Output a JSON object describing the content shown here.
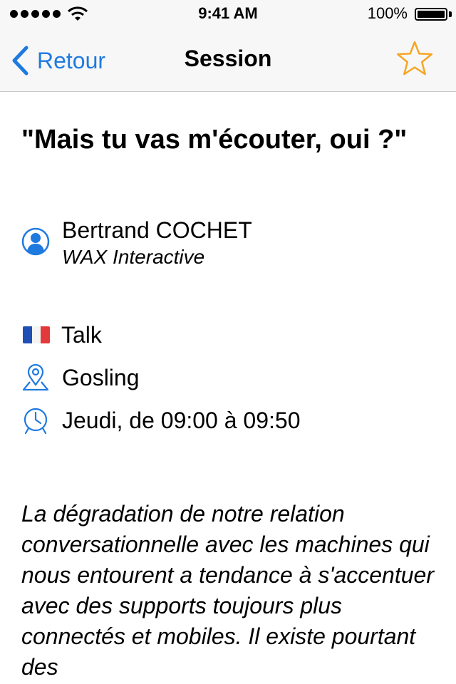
{
  "status_bar": {
    "time": "9:41 AM",
    "battery": "100%"
  },
  "nav": {
    "back_label": "Retour",
    "title": "Session",
    "icons": [
      "chevron-left-icon",
      "star-icon"
    ],
    "accent_color": "#1f7ae0",
    "favorite_color": "#f5a623"
  },
  "session": {
    "title": "\"Mais tu vas m'écouter, oui ?\"",
    "speaker": {
      "name": "Bertrand COCHET",
      "company": "WAX Interactive"
    },
    "type": "Talk",
    "language_flag": "french-flag-icon",
    "room": "Gosling",
    "time": "Jeudi, de 09:00 à 09:50",
    "description": "La dégradation de notre relation conversationnelle avec les machines qui nous entourent a tendance à s'accentuer avec des supports toujours plus connectés et mobiles. Il existe pourtant des"
  }
}
